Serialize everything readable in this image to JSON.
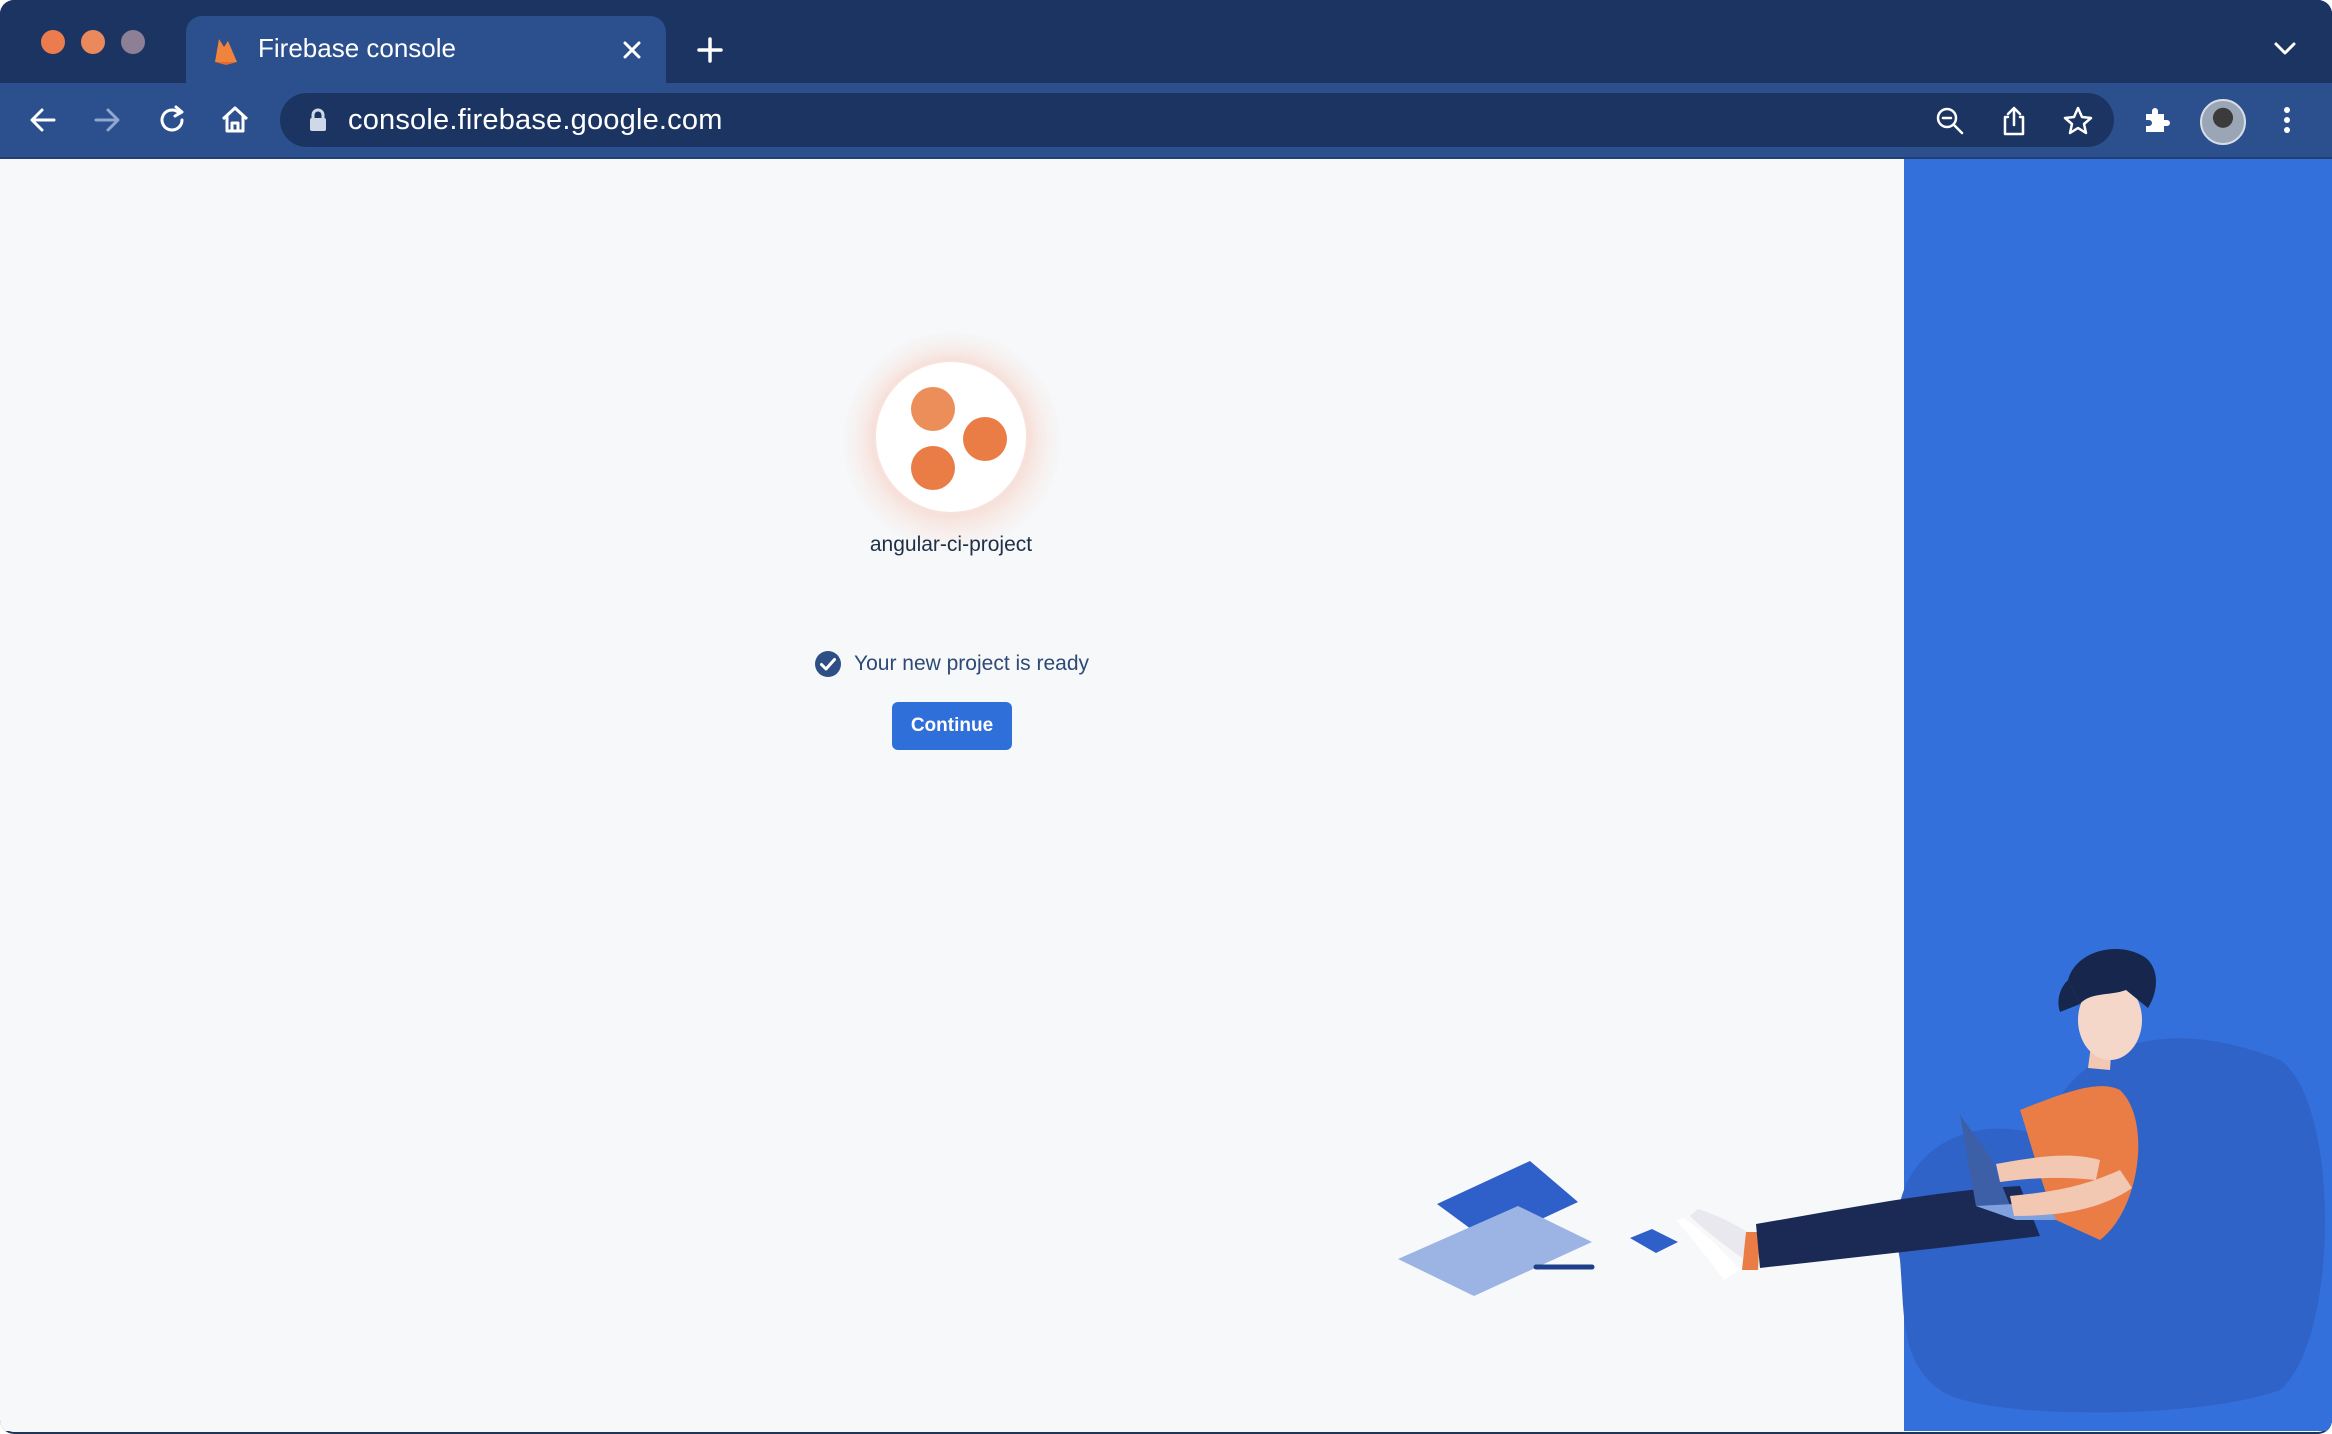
{
  "browser": {
    "tab": {
      "title": "Firebase console"
    },
    "address_bar": {
      "url": "console.firebase.google.com"
    }
  },
  "project": {
    "name": "angular-ci-project"
  },
  "status": {
    "message": "Your new project is ready"
  },
  "actions": {
    "continue_label": "Continue"
  },
  "colors": {
    "brand_blue": "#3370db",
    "button_blue": "#2f6fd9",
    "accent_orange": "#ea7d45",
    "tab_strip": "#1c3462",
    "toolbar": "#2c4f8e"
  }
}
